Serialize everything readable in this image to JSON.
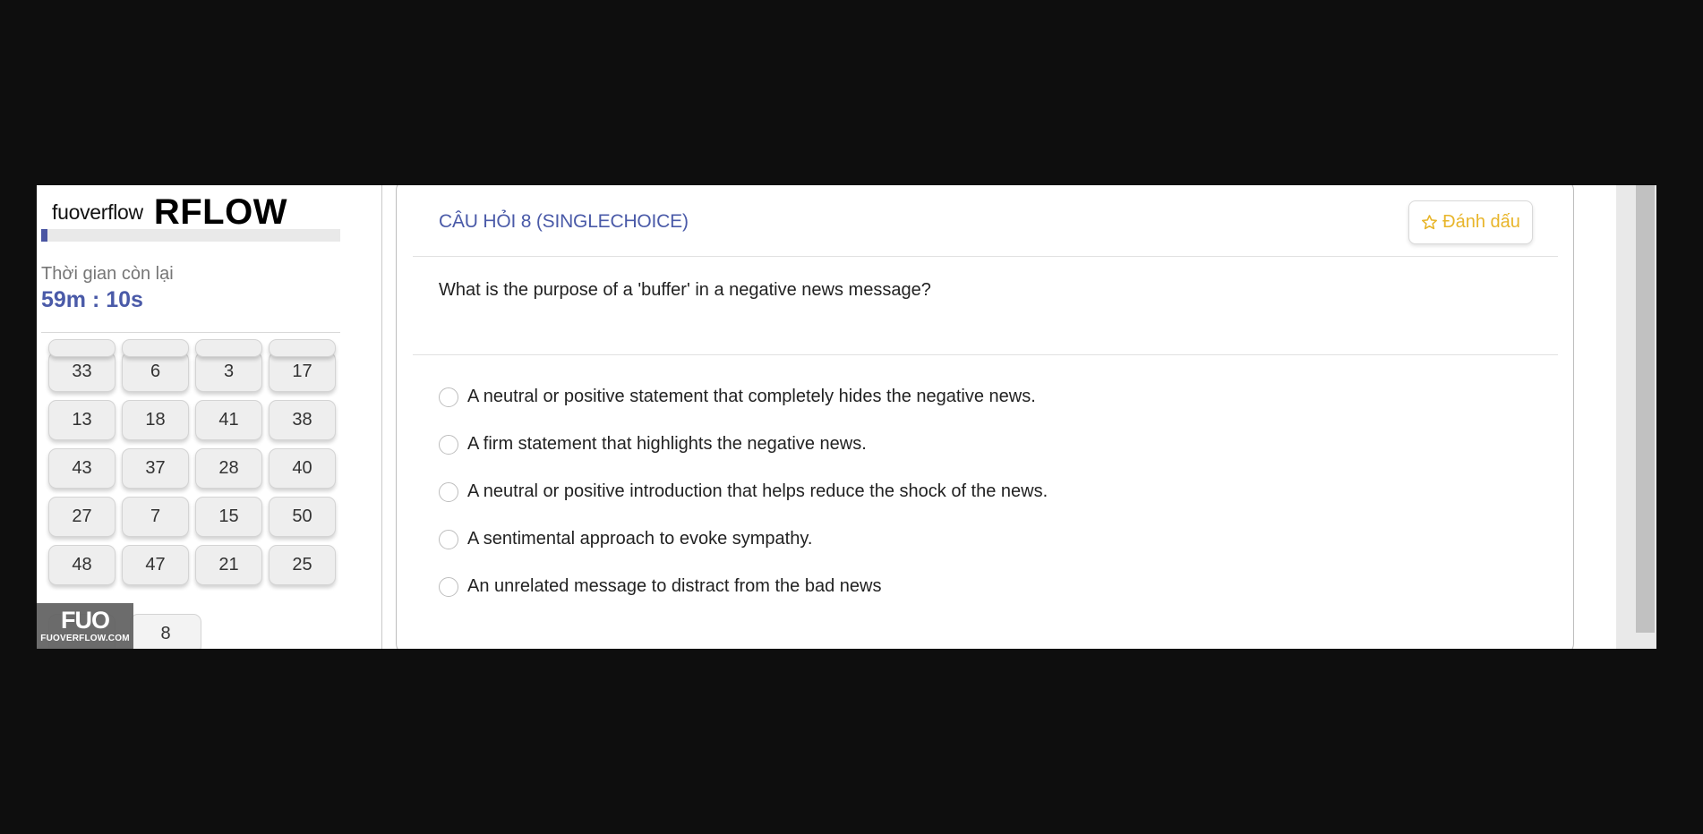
{
  "brand": {
    "small": "fuoverflow",
    "big": "RFLOW"
  },
  "progress": {
    "fraction": 0.02
  },
  "timer": {
    "label": "Thời gian còn lại",
    "value": "59m : 10s"
  },
  "grid": {
    "rows": [
      [
        "33",
        "6",
        "3",
        "17"
      ],
      [
        "13",
        "18",
        "41",
        "38"
      ],
      [
        "43",
        "37",
        "28",
        "40"
      ],
      [
        "27",
        "7",
        "15",
        "50"
      ],
      [
        "48",
        "47",
        "21",
        "25"
      ]
    ],
    "last_visible": "8"
  },
  "watermark": {
    "logo": "FUO",
    "text": "FUOVERFLOW.COM"
  },
  "question": {
    "title": "CÂU HỎI 8 (SINGLECHOICE)",
    "mark_label": "Đánh dấu",
    "text": "What is the purpose of a 'buffer' in a negative news message?",
    "options": [
      "A neutral or positive statement that completely hides the negative news.",
      "A firm statement that highlights the negative news.",
      "A neutral or positive introduction that helps reduce the shock of the news.",
      "A sentimental approach to evoke sympathy.",
      "An unrelated message to distract from the bad news"
    ]
  },
  "colors": {
    "accent": "#4a5aa8",
    "mark": "#e8b52a"
  }
}
